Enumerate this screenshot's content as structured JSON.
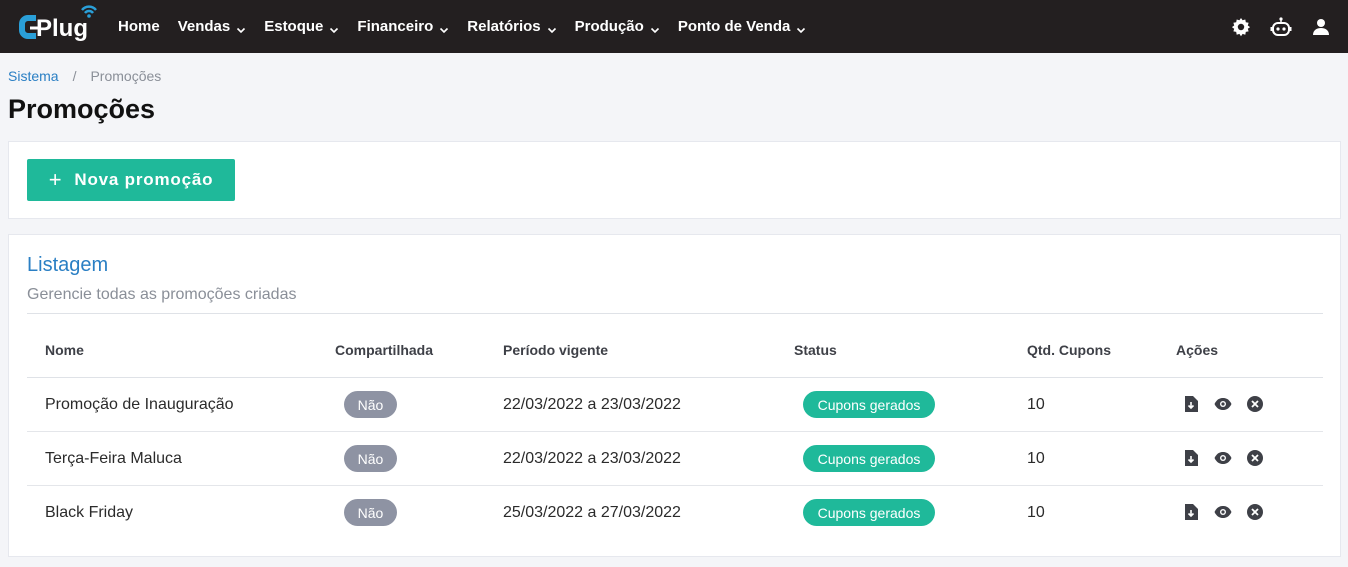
{
  "brand": {
    "logo_text": "CPlug",
    "accent": "#1fb99a",
    "link": "#2a7fc4"
  },
  "nav": {
    "items": [
      {
        "label": "Home",
        "dropdown": false
      },
      {
        "label": "Vendas",
        "dropdown": true
      },
      {
        "label": "Estoque",
        "dropdown": true
      },
      {
        "label": "Financeiro",
        "dropdown": true
      },
      {
        "label": "Relatórios",
        "dropdown": true
      },
      {
        "label": "Produção",
        "dropdown": true
      },
      {
        "label": "Ponto de Venda",
        "dropdown": true
      }
    ],
    "icons": [
      "gear-icon",
      "robot-icon",
      "user-icon"
    ]
  },
  "breadcrumb": {
    "root": "Sistema",
    "separator": "/",
    "current": "Promoções"
  },
  "page": {
    "title": "Promoções"
  },
  "toolbar": {
    "new_label": "Nova promoção"
  },
  "listing": {
    "title": "Listagem",
    "subtitle": "Gerencie todas as promoções criadas",
    "columns": {
      "name": "Nome",
      "shared": "Compartilhada",
      "period": "Período vigente",
      "status": "Status",
      "coupons": "Qtd. Cupons",
      "actions": "Ações"
    },
    "rows": [
      {
        "name": "Promoção de Inauguração",
        "shared": "Não",
        "period": "22/03/2022 a 23/03/2022",
        "status": "Cupons gerados",
        "coupons": "10"
      },
      {
        "name": "Terça-Feira Maluca",
        "shared": "Não",
        "period": "22/03/2022 a 23/03/2022",
        "status": "Cupons gerados",
        "coupons": "10"
      },
      {
        "name": "Black Friday",
        "shared": "Não",
        "period": "25/03/2022 a 27/03/2022",
        "status": "Cupons gerados",
        "coupons": "10"
      }
    ],
    "row_actions": [
      "file-download-icon",
      "eye-icon",
      "close-circle-icon"
    ]
  }
}
